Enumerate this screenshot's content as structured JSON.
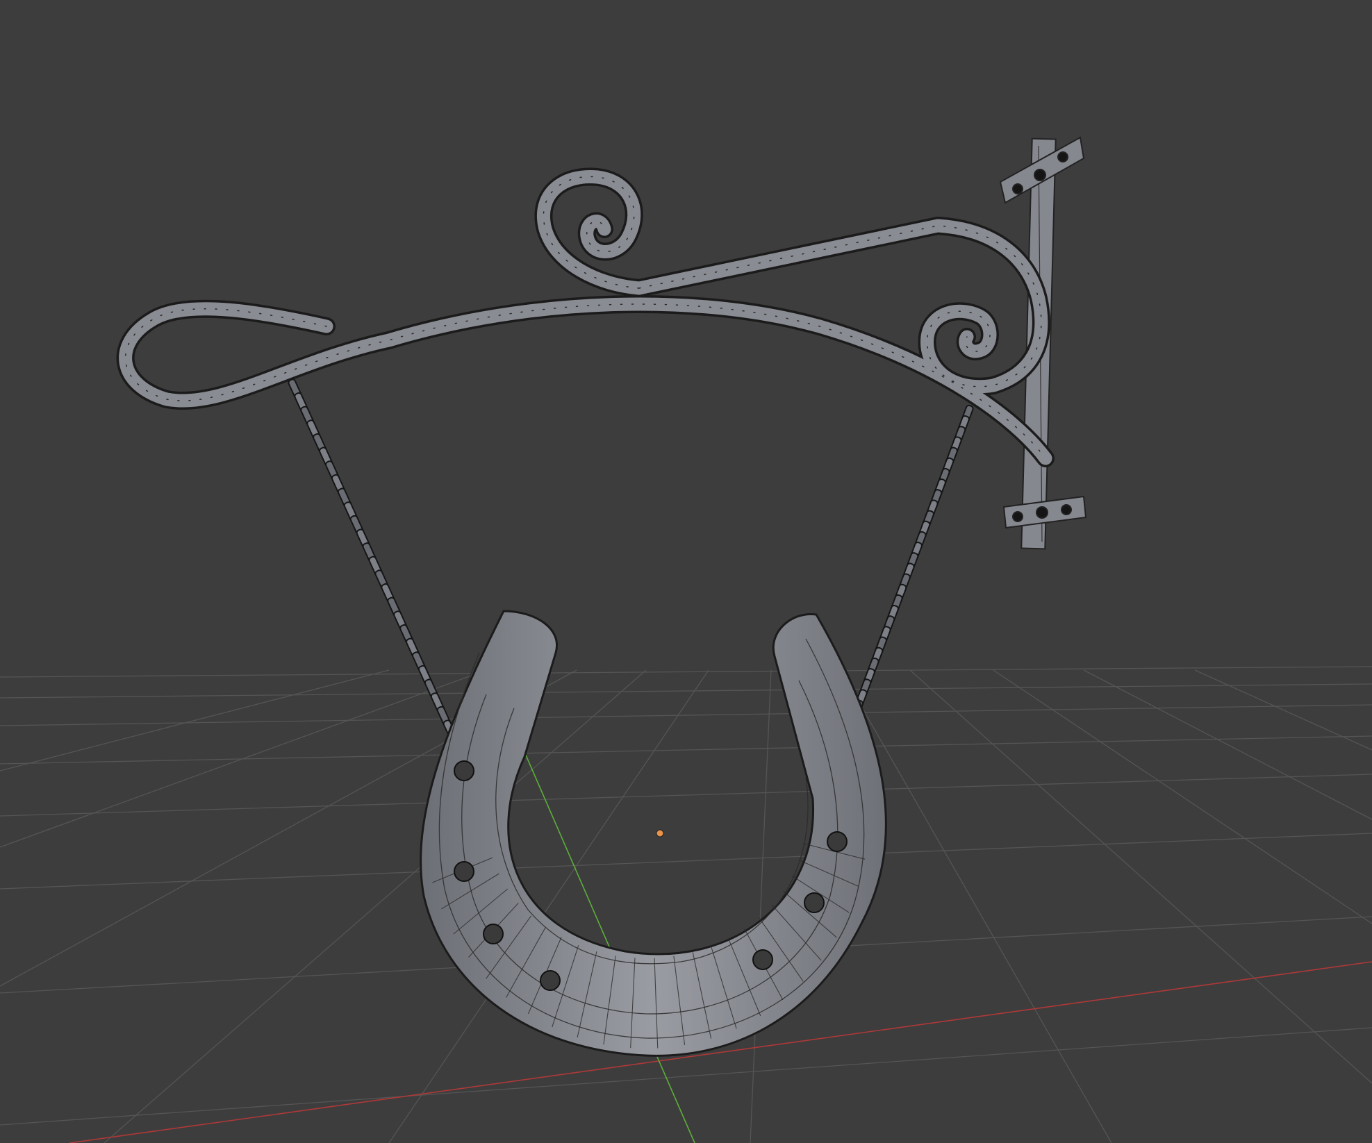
{
  "viewport": {
    "background": "#3d3d3d",
    "view_type": "perspective",
    "shading": "solid",
    "overlay": "wireframe-edit-mode",
    "grid_color": "#555555",
    "x_axis_color": "#b03838",
    "y_axis_color": "#5cae3a",
    "origin_marker_color": "#e8944a"
  },
  "model": {
    "parts": [
      "wall-plate",
      "bracket-arm",
      "upper-spiral",
      "inner-spiral",
      "left-curl",
      "left-chain",
      "right-chain",
      "horseshoe"
    ],
    "horseshoe_nail_holes": 7,
    "mesh_color": "#8a8c93",
    "wire_color": "#222222",
    "vertex_color": "#111111"
  }
}
